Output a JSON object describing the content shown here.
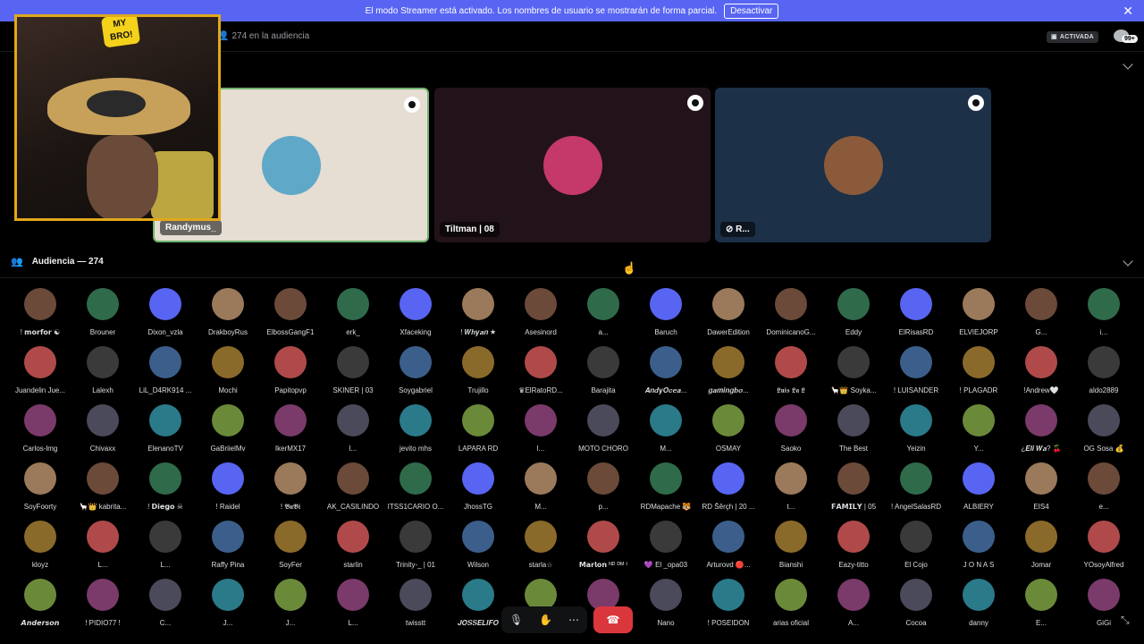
{
  "banner": {
    "text": "El modo Streamer está activado. Los nombres de usuario se mostrarán de forma parcial.",
    "button": "Desactivar",
    "close": "✕"
  },
  "topbar": {
    "audience_icon": "person-icon",
    "audience_text": "274 en la audiencia",
    "activada_label": "ACTIVADA",
    "chat_badge": "99+"
  },
  "webcam": {
    "logo_text": "MY BRO!"
  },
  "stage": {
    "tiles": [
      {
        "name": "Randymus_",
        "bg": "#e6ddd3",
        "avatar": "#5fa8c8",
        "border": "#6fb36f"
      },
      {
        "name": "Tiltman | 08",
        "bg": "#22131a",
        "avatar": "#c4386a",
        "border": ""
      },
      {
        "name": "R...",
        "bg": "#1c3047",
        "avatar": "#8a5a3a",
        "border": ""
      }
    ]
  },
  "audience": {
    "header_icon": "people-icon",
    "header": "Audiencia — 274",
    "rows": [
      [
        "! 𝗺𝗼𝗿𝗳𝗼𝗿 ☯",
        "Brouner",
        "Dixon_vzla",
        "DrakboyRus",
        "ElbossGangF1",
        "erk_",
        "Xfaceking",
        "! 𝑾𝒉𝒚𝒂𝒏 ★",
        "Asesinord",
        "a...",
        "Baruch",
        "DawerEdition",
        "DominicanoG...",
        "Eddy",
        "ElRisasRD",
        "ELVIEJORP",
        "G...",
        "i..."
      ],
      [
        "Juandelin Jue...",
        "Lalexh",
        "LiL_D4RK914 ...",
        "Mochi",
        "Papitopvp",
        "SKINER | 03",
        "Soygabriel",
        "Trujillo",
        "♛ElRatoRD...",
        "Barajita",
        "𝑨𝒏𝒅𝒚𝑶𝒄𝒆𝒂...",
        "𝒈𝒂𝒎𝒊𝒏𝒈𝒃𝒐...",
        "𝕷𝖚𝖎𝖘 𝕷𝖆 𝕷",
        "🦙👑 Soyka...",
        "! LUISANDER",
        "! PLAGADR",
        "!Andrew🤍",
        "aldo2889"
      ],
      [
        "Carlos-lmg",
        "Chivaxx",
        "ElenanoTV",
        "GaBriielMv",
        "IkerMX17",
        "l...",
        "jevito mhs",
        "LAPARA RD",
        "l...",
        "MOTO CHORO",
        "M...",
        "OSMAY",
        "Saoko",
        "The Best",
        "Yeizin",
        "Y...",
        "¿𝑬𝒍𝒊 𝑾𝒂? 🍒",
        "OG Sosa 💰"
      ],
      [
        "SoyFoorty",
        "🦙👑 kabrita...",
        "! 𝗗𝗶𝗲𝗴𝗼 ☠",
        "! Raidel",
        "! 𝕭𝖚𝕭𝖎",
        "AK_CASILINDO",
        "ITSS1CARIO O...",
        "JhossTG",
        "M...",
        "p...",
        "RDMapache 🐯",
        "RD Šêrçh | 20 ...",
        "t...",
        "𝗙𝗔𝗠𝗜𝗟𝗬 | 05",
        "! AngelSalasRD",
        "ALBIERY",
        "EIS4",
        "e..."
      ],
      [
        "kloyz",
        "L...",
        "L...",
        "Raffy Pina",
        "SoyFer",
        "starlin",
        "Trinity-_ | 01",
        "Wilson",
        "starla☆",
        "𝗠𝗮𝗿𝗹𝗼𝗻 ᴺᴰ ᴰᴹ ᵗ",
        "💜 El _opa03",
        "Arturovd 🔴...",
        "Bianshi",
        "Eazy-titto",
        "El Cojo",
        "J O N A S",
        "Jomar",
        "YOsoyAlfred"
      ],
      [
        "𝘼𝙣𝙙𝙚𝙧𝙨𝙤𝙣",
        "! PIDIO77 !",
        "C...",
        "J...",
        "J...",
        "L...",
        "twisstt",
        "𝑱𝑶𝑺𝑺𝑬𝑳𝑰𝑭𝑶",
        "",
        "",
        "Nano",
        "! POSEIDON",
        "arias oficial",
        "A...",
        "Cocoa",
        "danny",
        "E...",
        "GiGi"
      ]
    ]
  },
  "controls": {
    "mic_icon": "🎙",
    "hand_icon": "✋",
    "more_icon": "⋯",
    "leave_icon": "☎",
    "fullscreen_icon": "⤡"
  },
  "colors": {
    "banner": "#5865f2",
    "leave": "#da373c",
    "webcam_border": "#e1a81a"
  }
}
